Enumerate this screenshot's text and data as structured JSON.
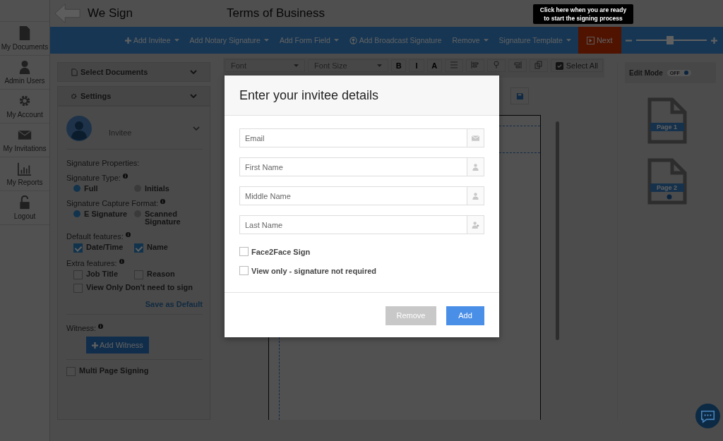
{
  "header": {
    "app_name": "We Sign",
    "document_title": "Terms of Business"
  },
  "nav": [
    {
      "label": "My Documents",
      "kind": "document"
    },
    {
      "label": "Admin Users",
      "kind": "user"
    },
    {
      "label": "My Account",
      "kind": "gear"
    },
    {
      "label": "My Invitations",
      "kind": "envelope"
    },
    {
      "label": "My Reports",
      "kind": "chart"
    },
    {
      "label": "Logout",
      "kind": "lock"
    }
  ],
  "toolbar": {
    "items": [
      {
        "label": "Add Invitee",
        "kind": "plus-menu"
      },
      {
        "label": "Add Notary Signature",
        "kind": "menu"
      },
      {
        "label": "Add Form Field",
        "kind": "menu"
      },
      {
        "label": "Add Broadcast Signature",
        "kind": "broadcast"
      },
      {
        "label": "Remove",
        "kind": "menu"
      },
      {
        "label": "Signature Template",
        "kind": "menu"
      }
    ],
    "next": "Next",
    "zoom": {
      "level": 0.48
    }
  },
  "tooltip": "Click here when you are ready to start the signing process",
  "left_panel": {
    "sections": [
      "Select Documents",
      "Settings"
    ],
    "invitee": "Invitee",
    "properties_heading": "Signature Properties:",
    "signature_type": {
      "label": "Signature Type:",
      "options": [
        {
          "label": "Full",
          "selected": true
        },
        {
          "label": "Initials",
          "selected": false
        }
      ]
    },
    "capture_format": {
      "label": "Signature Capture Format:",
      "options": [
        {
          "label": "E Signature",
          "selected": true
        },
        {
          "label": "Scanned Signature",
          "selected": false
        }
      ]
    },
    "default_features": {
      "label": "Default features:",
      "options": [
        {
          "label": "Date/Time",
          "checked": true
        },
        {
          "label": "Name",
          "checked": true
        }
      ]
    },
    "extra_features": {
      "label": "Extra features:",
      "options": [
        {
          "label": "Job Title",
          "checked": false
        },
        {
          "label": "Reason",
          "checked": false
        },
        {
          "label": "View Only Don't need to sign",
          "checked": false
        }
      ]
    },
    "save_default": "Save as Default",
    "witness_label": "Witness:",
    "add_witness": "Add Witness",
    "multi_page": {
      "label": "Multi Page Signing",
      "checked": false
    }
  },
  "editor_toolbar": {
    "font": "Font",
    "font_size": "Font Size",
    "format_buttons": [
      "B",
      "I",
      "A"
    ],
    "select_all": "Select All"
  },
  "right_panel": {
    "edit_mode": {
      "label": "Edit Mode",
      "state": "OFF",
      "on": false
    },
    "pages": [
      {
        "label": "Page 1",
        "marked": false
      },
      {
        "label": "Page 2",
        "marked": true
      }
    ]
  },
  "modal": {
    "title": "Enter your invitee details",
    "fields": [
      {
        "placeholder": "Email",
        "kind": "email"
      },
      {
        "placeholder": "First Name",
        "kind": "user"
      },
      {
        "placeholder": "Middle Name",
        "kind": "user"
      },
      {
        "placeholder": "Last Name",
        "kind": "user-add"
      }
    ],
    "checkboxes": [
      {
        "label": "Face2Face Sign",
        "checked": false
      },
      {
        "label": "View only - signature not required",
        "checked": false
      }
    ],
    "buttons": [
      {
        "label": "Remove",
        "kind": "secondary"
      },
      {
        "label": "Add",
        "kind": "primary"
      }
    ]
  }
}
